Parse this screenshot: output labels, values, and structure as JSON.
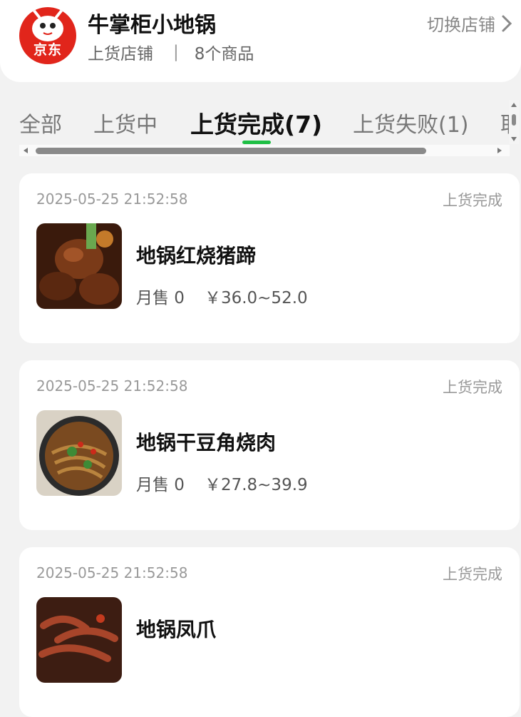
{
  "shop": {
    "logo_text": "京东",
    "name": "牛掌柜小地锅",
    "sub_label": "上货店铺",
    "separator": "|",
    "goods_count": "8个商品",
    "switch_label": "切换店铺"
  },
  "tabs": [
    {
      "label": "全部"
    },
    {
      "label": "上货中"
    },
    {
      "label": "上货完成(7)",
      "active": true
    },
    {
      "label": "上货失败(1)"
    },
    {
      "label": "取"
    }
  ],
  "items": [
    {
      "time": "2025-05-25 21:52:58",
      "status": "上货完成",
      "title": "地锅红烧猪蹄",
      "sales": "月售 0",
      "price": "￥36.0~52.0"
    },
    {
      "time": "2025-05-25 21:52:58",
      "status": "上货完成",
      "title": "地锅干豆角烧肉",
      "sales": "月售 0",
      "price": "￥27.8~39.9"
    },
    {
      "time": "2025-05-25 21:52:58",
      "status": "上货完成",
      "title": "地锅凤爪",
      "sales": "",
      "price": ""
    }
  ],
  "colors": {
    "accent": "#1fbf45",
    "brand": "#e1251b"
  }
}
